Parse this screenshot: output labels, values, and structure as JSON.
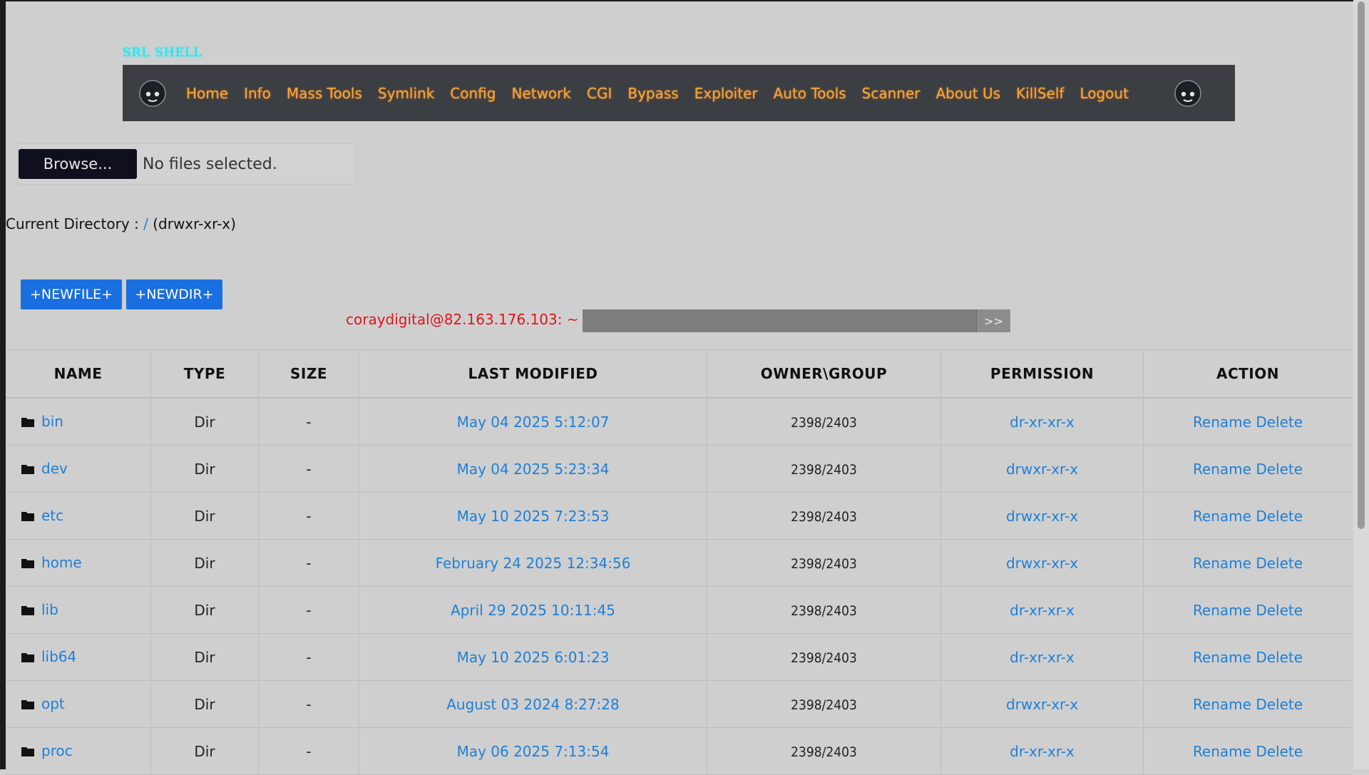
{
  "brand": "SRL SHELL",
  "nav": {
    "items": [
      "Home",
      "Info",
      "Mass Tools",
      "Symlink",
      "Config",
      "Network",
      "CGI",
      "Bypass",
      "Exploiter",
      "Auto Tools",
      "Scanner",
      "About Us",
      "KillSelf",
      "Logout"
    ],
    "logo_icon": "skull-avatar-icon"
  },
  "upload": {
    "browse_label": "Browse...",
    "status": "No files selected."
  },
  "current_dir": {
    "label": "Current Directory :",
    "path": "/",
    "perm": "(drwxr-xr-x)"
  },
  "buttons": {
    "newfile": "+NEWFILE+",
    "newdir": "+NEWDIR+"
  },
  "terminal": {
    "prompt": "coraydigital@82.163.176.103: ~ $",
    "submit": ">>",
    "value": ""
  },
  "table": {
    "headers": [
      "NAME",
      "TYPE",
      "SIZE",
      "LAST MODIFIED",
      "OWNER\\GROUP",
      "PERMISSION",
      "ACTION"
    ],
    "rows": [
      {
        "name": "bin",
        "type": "Dir",
        "size": "-",
        "modified": "May 04 2025 5:12:07",
        "owner": "2398/2403",
        "perm": "dr-xr-xr-x",
        "rename": "Rename",
        "delete": "Delete"
      },
      {
        "name": "dev",
        "type": "Dir",
        "size": "-",
        "modified": "May 04 2025 5:23:34",
        "owner": "2398/2403",
        "perm": "drwxr-xr-x",
        "rename": "Rename",
        "delete": "Delete"
      },
      {
        "name": "etc",
        "type": "Dir",
        "size": "-",
        "modified": "May 10 2025 7:23:53",
        "owner": "2398/2403",
        "perm": "drwxr-xr-x",
        "rename": "Rename",
        "delete": "Delete"
      },
      {
        "name": "home",
        "type": "Dir",
        "size": "-",
        "modified": "February 24 2025 12:34:56",
        "owner": "2398/2403",
        "perm": "drwxr-xr-x",
        "rename": "Rename",
        "delete": "Delete"
      },
      {
        "name": "lib",
        "type": "Dir",
        "size": "-",
        "modified": "April 29 2025 10:11:45",
        "owner": "2398/2403",
        "perm": "dr-xr-xr-x",
        "rename": "Rename",
        "delete": "Delete"
      },
      {
        "name": "lib64",
        "type": "Dir",
        "size": "-",
        "modified": "May 10 2025 6:01:23",
        "owner": "2398/2403",
        "perm": "dr-xr-xr-x",
        "rename": "Rename",
        "delete": "Delete"
      },
      {
        "name": "opt",
        "type": "Dir",
        "size": "-",
        "modified": "August 03 2024 8:27:28",
        "owner": "2398/2403",
        "perm": "drwxr-xr-x",
        "rename": "Rename",
        "delete": "Delete"
      },
      {
        "name": "proc",
        "type": "Dir",
        "size": "-",
        "modified": "May 06 2025 7:13:54",
        "owner": "2398/2403",
        "perm": "dr-xr-xr-x",
        "rename": "Rename",
        "delete": "Delete"
      }
    ]
  },
  "colors": {
    "nav_bg": "#3b3f44",
    "nav_text": "#f0a93a",
    "link": "#1f7fd6",
    "prompt": "#e1141e",
    "button": "#1a6fe0",
    "brand": "#19e3f0"
  }
}
